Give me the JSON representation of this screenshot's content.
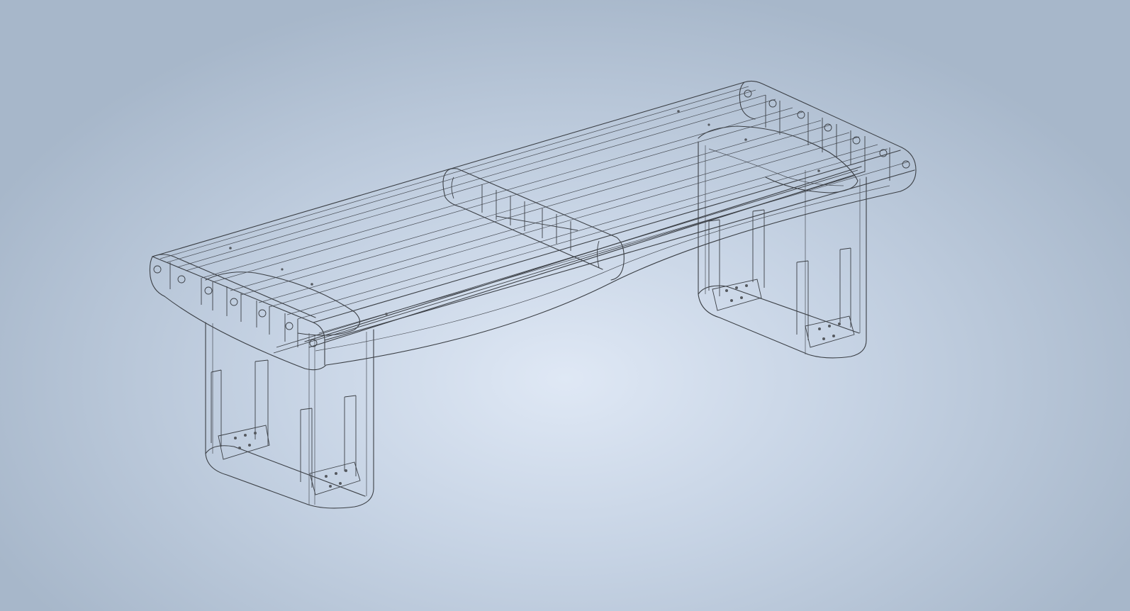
{
  "viewport": {
    "background": "#c6d3e4",
    "background_center": "#dfe8f5",
    "background_edge": "#a7b7ca",
    "render_style": "wireframe",
    "line_color": "#3c4046"
  },
  "model": {
    "icon": "bench-wireframe-icon"
  }
}
